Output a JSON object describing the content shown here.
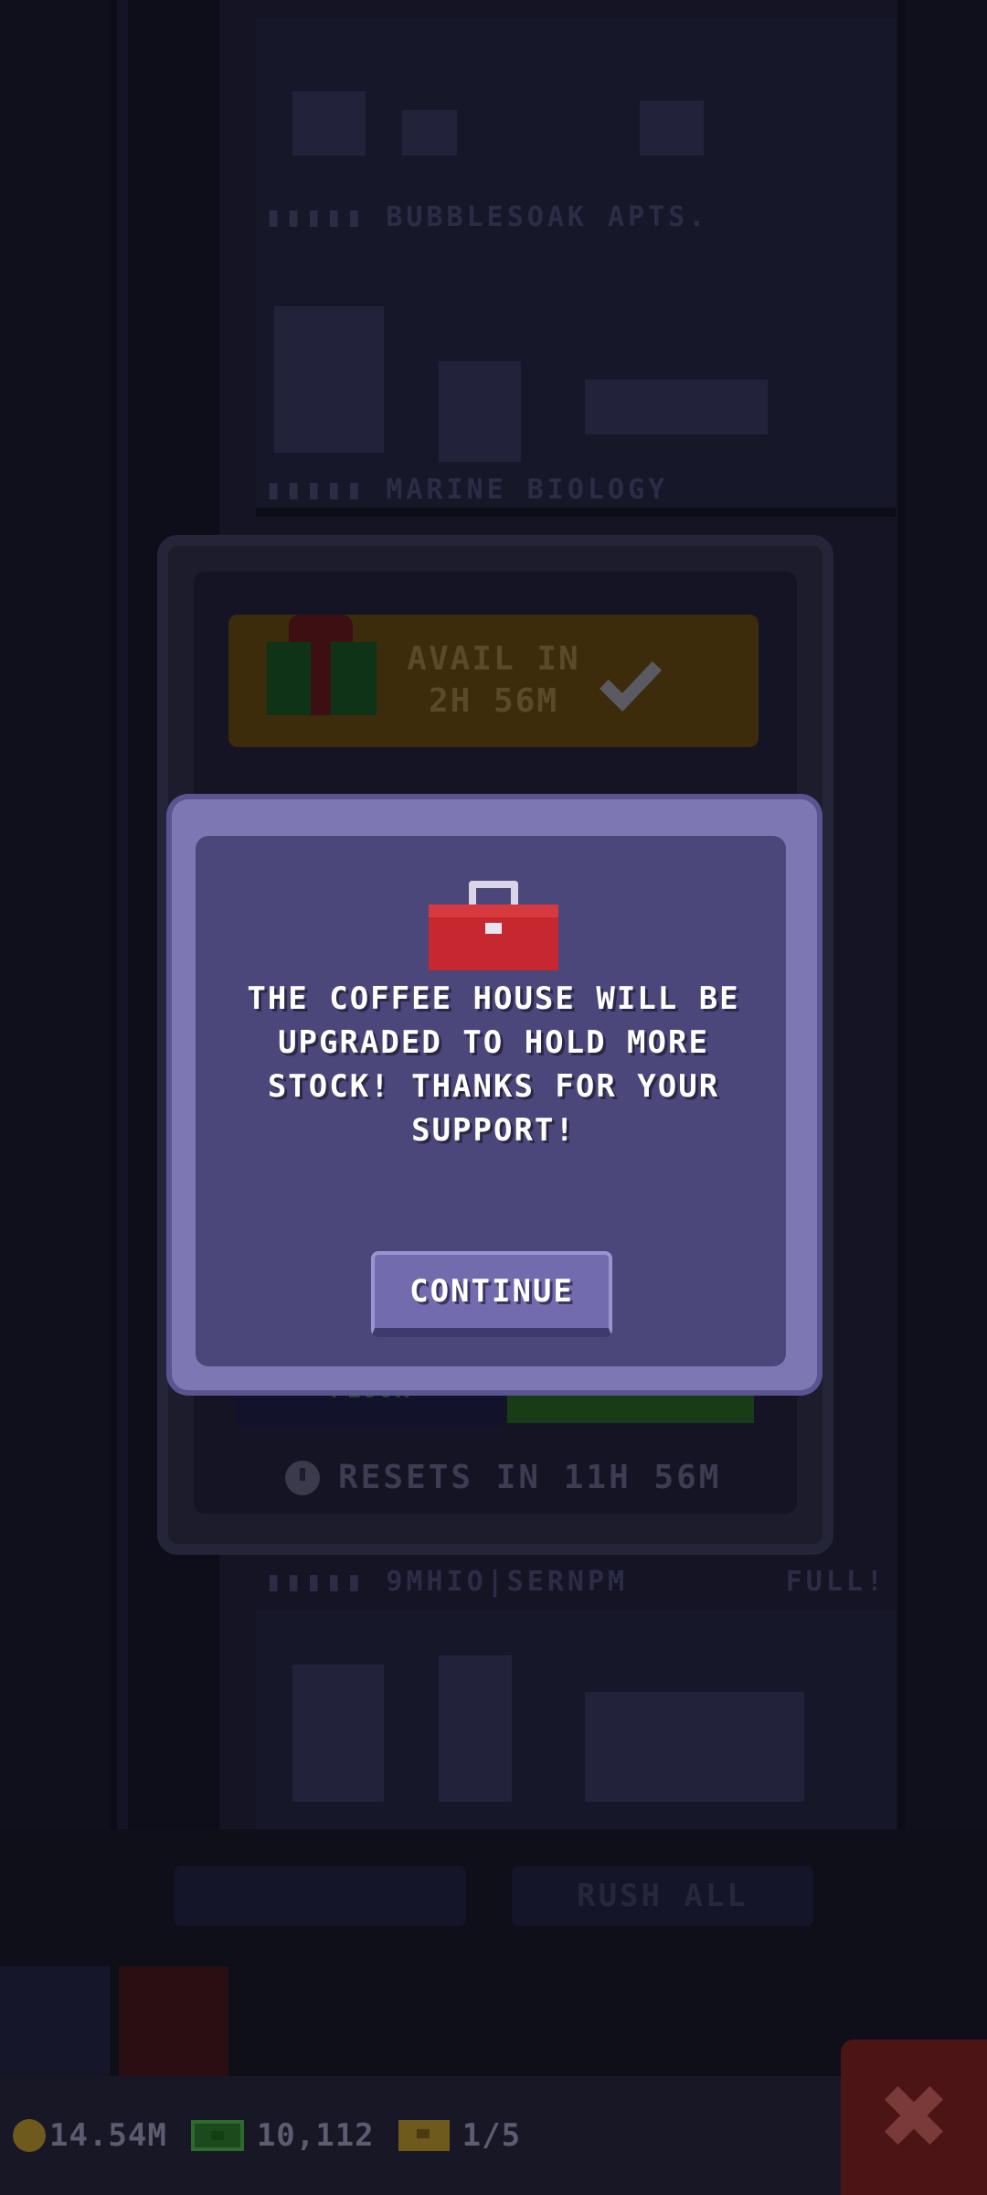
{
  "background": {
    "floors": [
      {
        "label": "▮▮▮▮▮ BUBBLESOAK APTS."
      },
      {
        "label": "▮▮▮▮▮ MARINE BIOLOGY"
      },
      {
        "label": "▮▮▮▮▮ 9MHIO|SERNPM",
        "status": "FULL!"
      }
    ],
    "buttons": {
      "left": "",
      "rush_all": "RUSH ALL"
    }
  },
  "hud": {
    "coins": "14.54M",
    "bux": "10,112",
    "tickets": "1/5",
    "close_icon": "✖"
  },
  "daily_panel": {
    "avail_text": "AVAIL IN\n2H 56M",
    "floor_tab": "FLOOR",
    "resets_text": "RESETS IN 11H 56M"
  },
  "dialog": {
    "icon": "toolbox-icon",
    "message": "THE COFFEE HOUSE WILL BE\nUPGRADED TO HOLD MORE\nSTOCK! THANKS FOR YOUR\nSUPPORT!",
    "continue_label": "CONTINUE"
  },
  "colors": {
    "dialog_border": "#7d77b4",
    "dialog_fill": "#4b477a",
    "button_fill": "#726bad",
    "toolbox_red": "#c7282f"
  }
}
